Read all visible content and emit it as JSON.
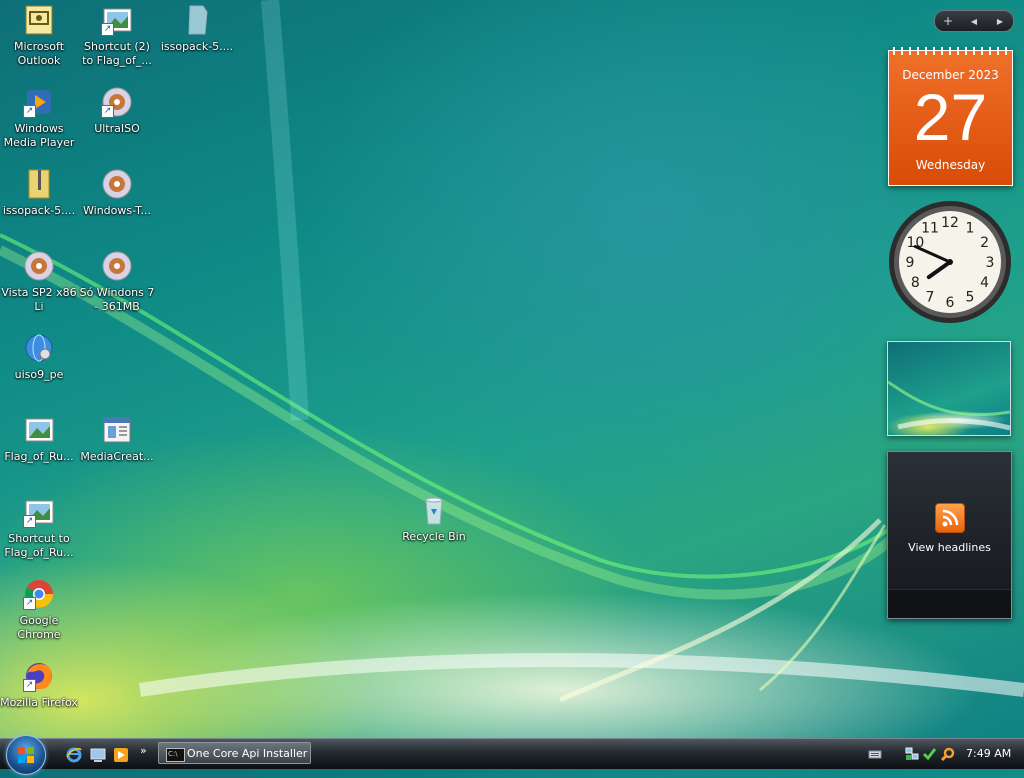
{
  "desktop_icons": [
    {
      "label": "Microsoft Outlook",
      "icon": "outlook-icon",
      "shortcut": false
    },
    {
      "label": "Shortcut (2) to Flag_of_...",
      "icon": "image-file-icon",
      "shortcut": true
    },
    {
      "label": "issopack-5....",
      "icon": "document-icon",
      "shortcut": false
    },
    {
      "label": "Windows Media Player",
      "icon": "media-player-icon",
      "shortcut": true
    },
    {
      "label": "UltraISO",
      "icon": "disc-icon",
      "shortcut": true
    },
    {
      "label": "issopack-5....",
      "icon": "zip-folder-icon",
      "shortcut": false
    },
    {
      "label": "Windows-T...",
      "icon": "disc-icon",
      "shortcut": false
    },
    {
      "label": "Vista SP2 x86 Li",
      "icon": "disc-icon",
      "shortcut": false
    },
    {
      "label": "Só Windons 7 - 361MB",
      "icon": "disc-icon",
      "shortcut": false
    },
    {
      "label": "uiso9_pe",
      "icon": "globe-installer-icon",
      "shortcut": false
    },
    {
      "label": "Flag_of_Ru...",
      "icon": "image-file-icon",
      "shortcut": false
    },
    {
      "label": "MediaCreat...",
      "icon": "application-window-icon",
      "shortcut": false
    },
    {
      "label": "Shortcut to Flag_of_Ru...",
      "icon": "image-file-icon",
      "shortcut": true
    },
    {
      "label": "Google Chrome",
      "icon": "chrome-icon",
      "shortcut": true
    },
    {
      "label": "Mozilla Firefox",
      "icon": "firefox-icon",
      "shortcut": true
    },
    {
      "label": "Recycle Bin",
      "icon": "recycle-bin-icon",
      "shortcut": false
    }
  ],
  "sidebar": {
    "controls": {
      "add": "+",
      "prev": "◀",
      "next": "▶"
    },
    "calendar": {
      "month_year": "December 2023",
      "day": "27",
      "weekday": "Wednesday"
    },
    "clock": {
      "hour": 7,
      "minute": 49
    },
    "feed": {
      "label": "View headlines"
    }
  },
  "taskbar": {
    "quick_launch": [
      "internet-explorer-icon",
      "show-desktop-icon",
      "media-player-icon"
    ],
    "overflow": "»",
    "task_button": {
      "label": "One Core Api Installer",
      "icon": "command-prompt-icon"
    },
    "tray": [
      "keyboard-icon",
      "network-icon",
      "security-check-icon",
      "search-icon"
    ],
    "time": "7:49 AM"
  }
}
